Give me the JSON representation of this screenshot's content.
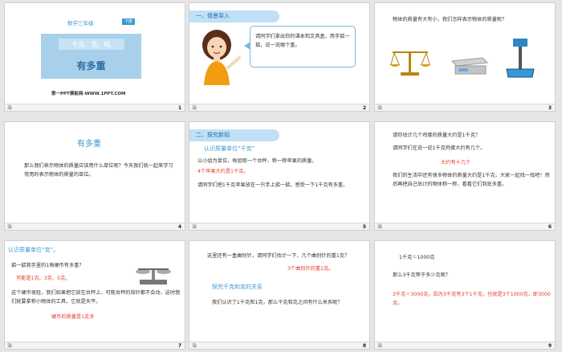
{
  "footer_icon": "治",
  "slides": [
    {
      "number": "1",
      "grade": "数学三年级",
      "volume_badge": "下册",
      "subtitle": "千克、克、吨",
      "title": "有多重",
      "watermark": "第一PPT模板网-WWW.1PPT.COM"
    },
    {
      "number": "2",
      "header": "一、情景导入",
      "bubble": "请同学们拿出你的课本和文具盒，用手掂一掂，说一说哪个重。"
    },
    {
      "number": "3",
      "question": "物体的质量有大有小，我们怎样表示物体的质量呢？"
    },
    {
      "number": "4",
      "title": "有多重",
      "body": "那么我们表示物体的质量应该用什么单位呢？今天我们就一起来学习常用的表示物体的质量的单位。"
    },
    {
      "number": "5",
      "header": "二、探究新知",
      "section": "认识质量单位“千克”",
      "line1": "以小组为单位，每组取一个台秤，称一称苹果的质量。",
      "line2": "4个苹果大约是1千克。",
      "line3": "请同学们把1千克苹果放在一只手上掂一掂，感受一下1千克有多重。"
    },
    {
      "number": "6",
      "q1": "请你估计几个鸡蛋的质量大约是1千克？",
      "q2": "请同学们在说一说1千克鸡蛋大约有几个。",
      "answer": "大约有十几个",
      "body": "我们的生活中还有很多物体的质量大约是1千克，大家一起找一找吧！然后再把自己估计的物体称一称，看看它们到底多重。"
    },
    {
      "number": "7",
      "section": "认识质量单位“克”。",
      "q1": "掂一掂我手里的1角硬币有多重？",
      "a1": "可能是1克、3克、5克。",
      "body": "这个硬币很轻，我们如果把它放在台秤上，可能台秤的指针都不会动，这时我们就要拿称小物体的工具，它就是天平。",
      "answer": "硬币的质量是1克多"
    },
    {
      "number": "8",
      "intro": "这里还有一盒曲别针，请同学们估计一下，几个曲别针的重1克？",
      "intro_answer": "3个曲别针的重1克。",
      "section": "探究千克和克的关系",
      "question": "我们认识了1千克和1克，那么千克和克之间有什么关系呢？"
    },
    {
      "number": "9",
      "eq": "1千克＝1000克",
      "q": "那么3千克等于多少克呢？",
      "answer": "3千克＝3000克，因为3千克有3个1千克，也就是3个1000克，即3000克。"
    }
  ],
  "colors": {
    "accent_blue": "#3d98d3",
    "highlight_red": "#e23b2c",
    "header_bg": "#bfe0f5"
  }
}
